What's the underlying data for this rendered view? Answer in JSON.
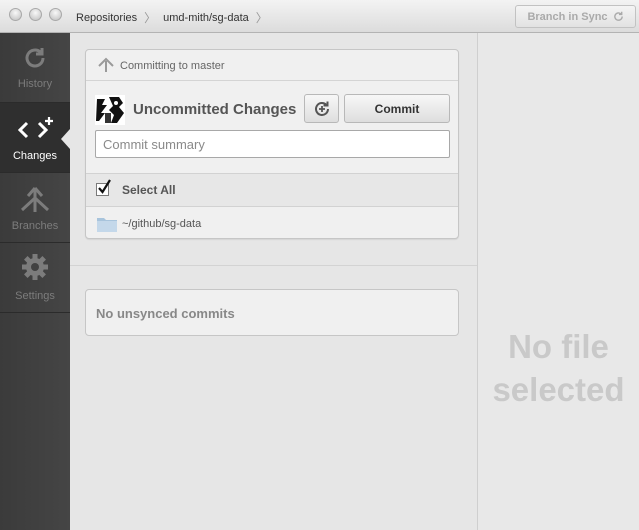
{
  "breadcrumb": {
    "root": "Repositories",
    "repo": "umd-mith/sg-data"
  },
  "toolbar": {
    "sync_label": "Branch in Sync"
  },
  "sidebar": {
    "items": [
      {
        "label": "History",
        "icon": "history-icon"
      },
      {
        "label": "Changes",
        "icon": "changes-icon",
        "active": true
      },
      {
        "label": "Branches",
        "icon": "branches-icon"
      },
      {
        "label": "Settings",
        "icon": "gear-icon"
      }
    ]
  },
  "commit_panel": {
    "branch_text": "Committing to master",
    "title": "Uncommitted Changes",
    "commit_label": "Commit",
    "summary_placeholder": "Commit summary",
    "summary_value": "",
    "select_all_label": "Select All",
    "select_all_checked": true,
    "folder_path": "~/github/sg-data"
  },
  "unsynced": {
    "text": "No unsynced commits"
  },
  "file_pane": {
    "line1": "No file",
    "line2": "selected"
  }
}
